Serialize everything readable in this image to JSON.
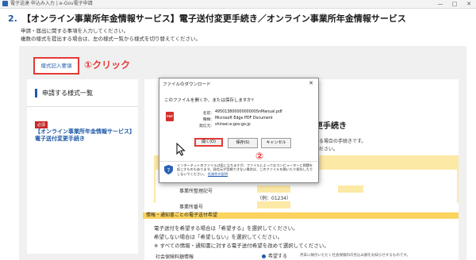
{
  "window": {
    "title": "電子送達 申込み入力 | e-Gov電子申請",
    "minimize": "—",
    "maximize": "□",
    "close": "✕"
  },
  "page": {
    "heading_num": "2.",
    "heading": "【オンライン事業所年金情報サービス】電子送付変更手続き／オンライン事業所年金情報サービス",
    "intro1": "申請・届出に関する事項を入力してください。",
    "intro2": "複数の様式を提出する場合は、左の様式一覧から様式を切り替えてください。"
  },
  "annotation": {
    "form_button": "様式記入要領",
    "click1": "①クリック",
    "step2": "②"
  },
  "left_panel": {
    "title": "申請する様式一覧",
    "badge": "必須",
    "form_link": "【オンライン事業所年金情報サービス】電子送付変更手続き"
  },
  "right_panel": {
    "title": "更手続き",
    "text1": "する場合の手続きです。",
    "text2": "ください。",
    "field1_label": "事業所整理記号",
    "field1_hint": "（例：01234）",
    "field2_label": "事業所番号",
    "section_header": "情報・通知書ごとの電子送付希望",
    "body1": "電子送付を希望する場合は「希望する」を選択してください。",
    "body2": "希望しない場合は「希望しない」を選択してください。",
    "body3": "※ すべての情報・通知書に対する電子送付希望を改めて選択してください。",
    "bottom_label": "社会保険料額情報",
    "radio_label": "希望する",
    "small_note": "月末に納付いただく社会保険料の見込み額をお知らせするものです。"
  },
  "dialog": {
    "title": "ファイルのダウンロード",
    "close": "✕",
    "question": "このファイルを開くか、または保存しますか?",
    "pdf_label": "PDF",
    "name_label": "名前:",
    "name_value": "49501380000000000SnManual.pdf",
    "type_label": "種類:",
    "type_value": "Microsoft Edge PDF Document",
    "from_label": "発信元:",
    "from_value": "shinsei.e-gov.go.jp",
    "open_btn": "開く(O)",
    "save_btn": "保存(S)",
    "cancel_btn": "キャンセル",
    "warning": "インターネットのファイルは役に立ちますが、ファイルによってはコンピューターに問題を起こすものもあります。発信元が信頼できない場合は、このファイルを開いたり保存したりしないでください。",
    "warning_link": "危険性の説明"
  }
}
